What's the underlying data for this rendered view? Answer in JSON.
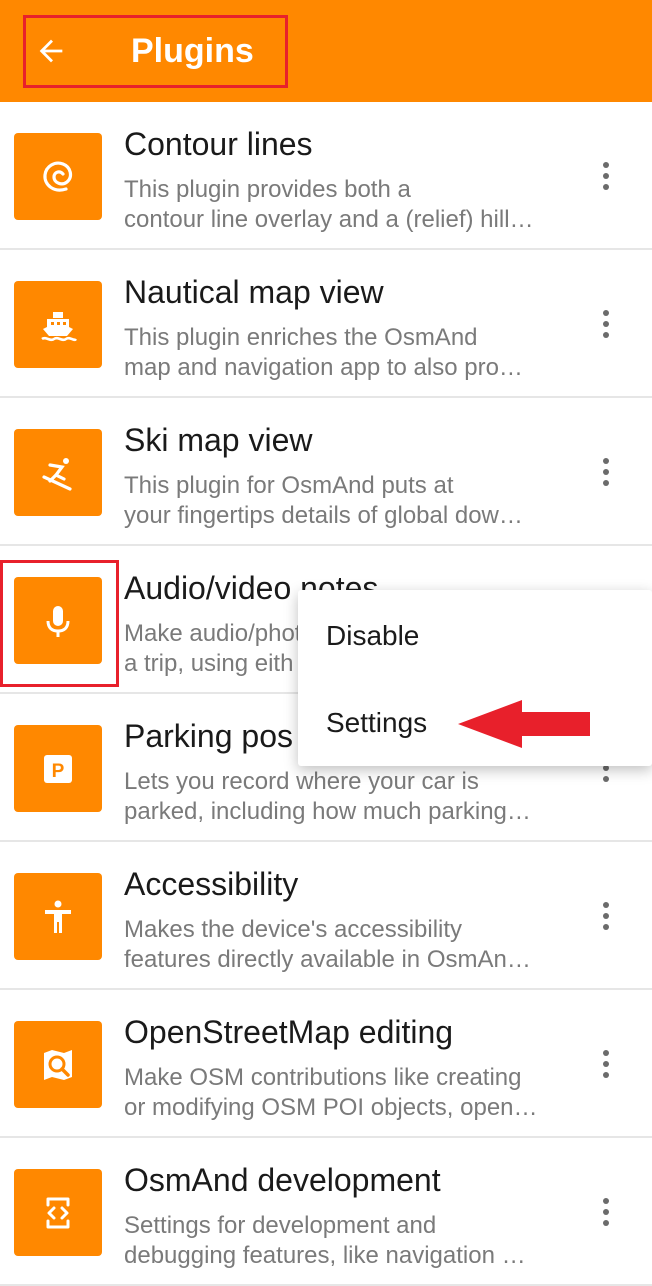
{
  "header": {
    "title": "Plugins",
    "back_icon": "arrow-left-icon"
  },
  "colors": {
    "accent": "#ff8800",
    "highlight": "#e8202b",
    "divider": "#e6e6e6"
  },
  "plugins": [
    {
      "title": "Contour lines",
      "line1": "This plugin provides both a",
      "line2": "contour line overlay and a (relief) hill…",
      "icon": "contour-icon"
    },
    {
      "title": "Nautical map view",
      "line1": "This plugin enriches the OsmAnd",
      "line2": "map and navigation app to also pro…",
      "icon": "ship-icon"
    },
    {
      "title": "Ski map view",
      "line1": "This plugin for OsmAnd puts at",
      "line2": "your fingertips details of global dow…",
      "icon": "skier-icon"
    },
    {
      "title": "Audio/video notes",
      "line1": "Make audio/photo",
      "line2": "a trip, using eith",
      "icon": "microphone-icon"
    },
    {
      "title": "Parking pos",
      "line1": "Lets you record where your car is",
      "line2": "parked, including how much parking…",
      "icon": "parking-icon"
    },
    {
      "title": "Accessibility",
      "line1": "Makes the device's accessibility",
      "line2": "features directly available in OsmAn…",
      "icon": "accessibility-icon"
    },
    {
      "title": "OpenStreetMap editing",
      "line1": "Make OSM contributions like creating",
      "line2": "or modifying OSM POI objects, open…",
      "icon": "osm-edit-icon"
    },
    {
      "title": "OsmAnd development",
      "line1": "Settings for development and",
      "line2": "debugging features, like navigation …",
      "icon": "developer-icon"
    }
  ],
  "menu": {
    "disable": "Disable",
    "settings": "Settings"
  }
}
